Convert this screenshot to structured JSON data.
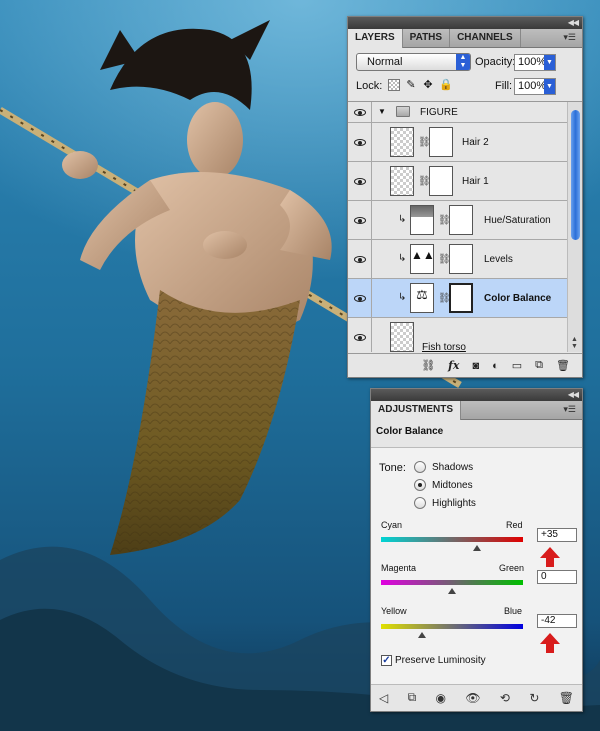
{
  "layers_panel": {
    "tabs": [
      "LAYERS",
      "PATHS",
      "CHANNELS"
    ],
    "active_tab": "LAYERS",
    "blend_mode": "Normal",
    "opacity_label": "Opacity:",
    "opacity_value": "100%",
    "lock_label": "Lock:",
    "fill_label": "Fill:",
    "fill_value": "100%",
    "group_name": "FIGURE",
    "layers": [
      {
        "name": "Hair 2",
        "type": "masked"
      },
      {
        "name": "Hair 1",
        "type": "masked"
      },
      {
        "name": "Hue/Saturation",
        "type": "adjustment",
        "clipped": true
      },
      {
        "name": "Levels",
        "type": "adjustment",
        "clipped": true
      },
      {
        "name": "Color Balance",
        "type": "adjustment",
        "clipped": true,
        "selected": true
      },
      {
        "name": "Fish torso",
        "type": "pixel"
      }
    ],
    "footer_icons": [
      "link-icon",
      "fx-icon",
      "add-mask-icon",
      "new-adjustment-icon",
      "new-group-icon",
      "new-layer-icon",
      "trash-icon"
    ]
  },
  "adjustments_panel": {
    "tab": "ADJUSTMENTS",
    "title": "Color Balance",
    "tone_label": "Tone:",
    "tones": [
      "Shadows",
      "Midtones",
      "Highlights"
    ],
    "selected_tone": "Midtones",
    "sliders": [
      {
        "left": "Cyan",
        "right": "Red",
        "value": "+35",
        "level": 0.675,
        "gradient": [
          "#00d4d4",
          "#e00000"
        ],
        "highlighted": true
      },
      {
        "left": "Magenta",
        "right": "Green",
        "value": "0",
        "level": 0.5,
        "gradient": [
          "#e000e0",
          "#00c000"
        ],
        "highlighted": false
      },
      {
        "left": "Yellow",
        "right": "Blue",
        "value": "-42",
        "level": 0.29,
        "gradient": [
          "#e0e000",
          "#0000e0"
        ],
        "highlighted": true
      }
    ],
    "preserve_luminosity_label": "Preserve Luminosity",
    "preserve_luminosity": true,
    "footer_icons": [
      "back-arrow-icon",
      "clip-to-layer-icon",
      "visibility-toggle-icon",
      "eye-icon",
      "previous-state-icon",
      "reset-icon",
      "trash-icon"
    ]
  },
  "colors": {
    "accent_arrow": "#d81c1c",
    "selection": "#bcd6f8",
    "scroll_blue": "#2b6fd8"
  }
}
